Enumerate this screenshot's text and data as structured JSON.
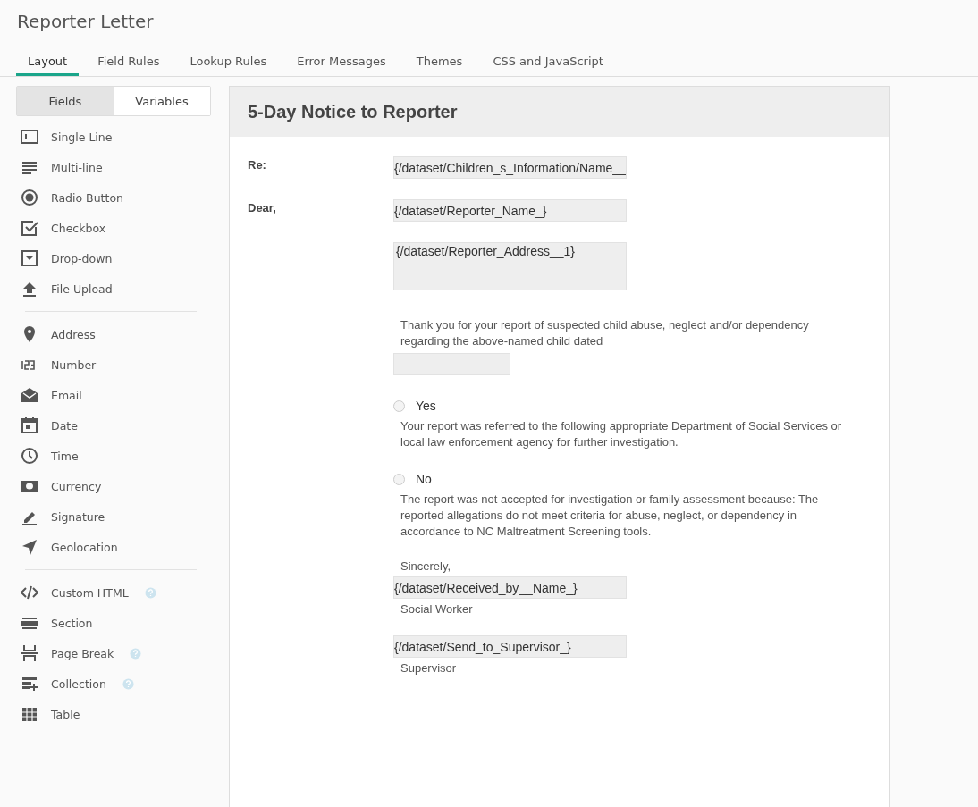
{
  "page_title": "Reporter Letter",
  "tabs": [
    {
      "label": "Layout",
      "selected": true
    },
    {
      "label": "Field Rules",
      "selected": false
    },
    {
      "label": "Lookup Rules",
      "selected": false
    },
    {
      "label": "Error Messages",
      "selected": false
    },
    {
      "label": "Themes",
      "selected": false
    },
    {
      "label": "CSS and JavaScript",
      "selected": false
    }
  ],
  "sidebar": {
    "toggle": [
      {
        "label": "Fields",
        "selected": true
      },
      {
        "label": "Variables",
        "selected": false
      }
    ],
    "groups": [
      [
        {
          "label": "Single Line",
          "help": false
        },
        {
          "label": "Multi-line",
          "help": false
        },
        {
          "label": "Radio Button",
          "help": false
        },
        {
          "label": "Checkbox",
          "help": false
        },
        {
          "label": "Drop-down",
          "help": false
        },
        {
          "label": "File Upload",
          "help": false
        }
      ],
      [
        {
          "label": "Address",
          "help": false
        },
        {
          "label": "Number",
          "help": false
        },
        {
          "label": "Email",
          "help": false
        },
        {
          "label": "Date",
          "help": false
        },
        {
          "label": "Time",
          "help": false
        },
        {
          "label": "Currency",
          "help": false
        },
        {
          "label": "Signature",
          "help": false
        },
        {
          "label": "Geolocation",
          "help": false
        }
      ],
      [
        {
          "label": "Custom HTML",
          "help": true
        },
        {
          "label": "Section",
          "help": false
        },
        {
          "label": "Page Break",
          "help": true
        },
        {
          "label": "Collection",
          "help": true
        },
        {
          "label": "Table",
          "help": false
        }
      ]
    ]
  },
  "form": {
    "title": "5-Day Notice to Reporter",
    "blocks": [
      {
        "kind": "field",
        "label": "Re:",
        "value": "{/dataset/Children_s_Information/Name__"
      },
      {
        "kind": "field",
        "label": "Dear,",
        "value": "{/dataset/Reporter_Name_}"
      },
      {
        "kind": "textarea",
        "value": "{/dataset/Reporter_Address__1}"
      },
      {
        "kind": "paragraph",
        "text": "Thank you for your report of suspected child abuse, neglect and/or dependency regarding the above-named child dated"
      },
      {
        "kind": "short-field"
      },
      {
        "kind": "radio",
        "label": "Yes",
        "selected": false
      },
      {
        "kind": "paragraph",
        "text": "Your report was referred to the following appropriate Department of Social Services or local law enforcement agency for further investigation."
      },
      {
        "kind": "radio",
        "label": "No",
        "selected": false
      },
      {
        "kind": "paragraph",
        "text": "The report was not accepted for investigation or family assessment because: The reported allegations do not meet criteria for abuse, neglect, or dependency in accordance to NC Maltreatment Screening tools."
      },
      {
        "kind": "caption",
        "text": "Sincerely,"
      },
      {
        "kind": "field",
        "value": "{/dataset/Received_by__Name_}"
      },
      {
        "kind": "caption",
        "text": "Social Worker"
      },
      {
        "kind": "field",
        "value": "{/dataset/Send_to_Supervisor_}"
      },
      {
        "kind": "caption",
        "text": "Supervisor"
      }
    ]
  }
}
